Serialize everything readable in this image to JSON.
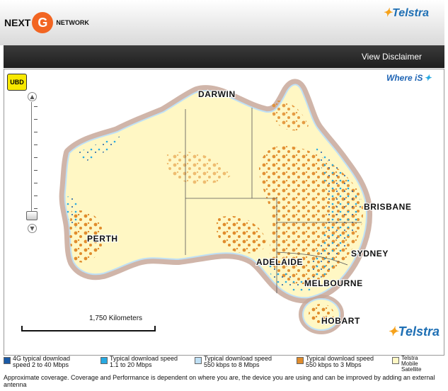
{
  "header": {
    "next_logo": {
      "left": "NEXT",
      "right": "NETWORK"
    },
    "telstra_logo": "Telstra"
  },
  "toolbar": {
    "disclaimer_label": "View Disclaimer"
  },
  "map": {
    "ubd_label": "UBD",
    "whereis_label": "Where iS",
    "scale_label": "1,750 Kilometers",
    "watermark": "Telstra",
    "cities": [
      {
        "name": "DARWIN"
      },
      {
        "name": "PERTH"
      },
      {
        "name": "BRISBANE"
      },
      {
        "name": "SYDNEY"
      },
      {
        "name": "ADELAIDE"
      },
      {
        "name": "MELBOURNE"
      },
      {
        "name": "HOBART"
      }
    ],
    "colors": {
      "land": "#fff7c4",
      "coast_shade": "#c8a89a",
      "coverage_4g": "#1a5aa6",
      "coverage_1_20": "#27a9e1",
      "coverage_550_8": "#bfe0f5",
      "coverage_550_3": "#e08c2c",
      "satellite": "#fff7c4"
    }
  },
  "legend": [
    {
      "line1": "4G typical download",
      "line2": "speed 2 to 40 Mbps",
      "color": "#1a5aa6"
    },
    {
      "line1": "Typical download speed",
      "line2": "1.1 to 20 Mbps",
      "color": "#27a9e1"
    },
    {
      "line1": "Typical download speed",
      "line2": "550 kbps to 8 Mbps",
      "color": "#bfe0f5"
    },
    {
      "line1": "Typical download speed",
      "line2": "550 kbps to 3 Mbps",
      "color": "#e08c2c"
    },
    {
      "line1": "Telstra",
      "line2": "Mobile",
      "line3": "Satellite",
      "color": "#fff7c4"
    }
  ],
  "footnote": "Approximate coverage. Coverage and Performance is dependent on where you are, the device you are using and can be improved by adding an external antenna"
}
